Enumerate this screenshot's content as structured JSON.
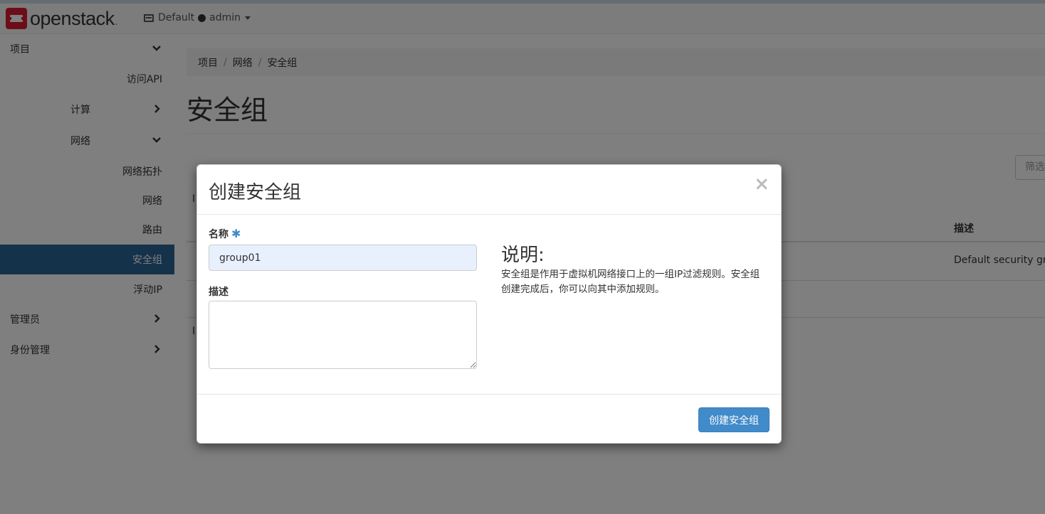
{
  "navbar": {
    "logo_text": "openstack",
    "logo_suffix": ".",
    "domain": "Default",
    "user": "admin"
  },
  "sidebar": {
    "items": [
      {
        "label": "项目",
        "level": 1,
        "chevron": "down"
      },
      {
        "label": "访问API",
        "level": 3
      },
      {
        "label": "计算",
        "level": 2,
        "chevron": "right"
      },
      {
        "label": "网络",
        "level": 2,
        "chevron": "down"
      },
      {
        "label": "网络拓扑",
        "level": 3
      },
      {
        "label": "网络",
        "level": 3
      },
      {
        "label": "路由",
        "level": 3
      },
      {
        "label": "安全组",
        "level": 3,
        "active": true
      },
      {
        "label": "浮动IP",
        "level": 3
      },
      {
        "label": "管理员",
        "level": 1,
        "chevron": "right"
      },
      {
        "label": "身份管理",
        "level": 1,
        "chevron": "right"
      }
    ]
  },
  "breadcrumb": [
    "项目",
    "网络",
    "安全组"
  ],
  "page_title": "安全组",
  "filter_placeholder": "筛选",
  "table": {
    "caption_top": "I",
    "caption_bottom": "I",
    "header_desc": "描述",
    "row_desc": "Default security grou"
  },
  "modal": {
    "title": "创建安全组",
    "close_label": "×",
    "name_label": "名称",
    "required_mark": "✱",
    "name_value": "group01",
    "desc_label": "描述",
    "desc_value": "",
    "help_title": "说明:",
    "help_text": "安全组是作用于虚拟机网络接口上的一组IP过滤规则。安全组创建完成后，你可以向其中添加规则。",
    "submit_label": "创建安全组"
  },
  "colors": {
    "accent": "#428bca",
    "active_sidebar": "#2a6496",
    "brand_red": "#da1a32"
  }
}
